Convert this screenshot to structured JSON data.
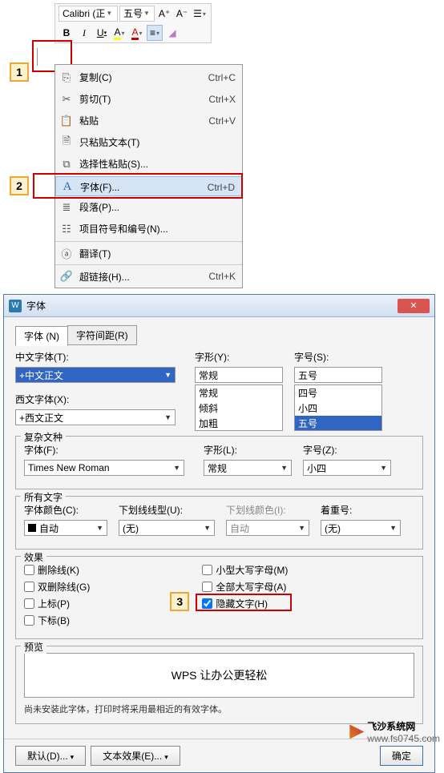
{
  "toolbar": {
    "font": "Calibri (正",
    "size": "五号",
    "inc": "A⁺",
    "dec": "A⁻"
  },
  "ctx": {
    "copy": {
      "label": "复制(C)",
      "sc": "Ctrl+C"
    },
    "cut": {
      "label": "剪切(T)",
      "sc": "Ctrl+X"
    },
    "paste": {
      "label": "粘贴",
      "sc": "Ctrl+V"
    },
    "paste_text": {
      "label": "只粘贴文本(T)"
    },
    "paste_special": {
      "label": "选择性粘贴(S)..."
    },
    "font": {
      "label": "字体(F)...",
      "sc": "Ctrl+D"
    },
    "paragraph": {
      "label": "段落(P)..."
    },
    "bullets": {
      "label": "项目符号和编号(N)..."
    },
    "translate": {
      "label": "翻译(T)"
    },
    "hyperlink": {
      "label": "超链接(H)...",
      "sc": "Ctrl+K"
    }
  },
  "callouts": {
    "c1": "1",
    "c2": "2",
    "c3": "3"
  },
  "dlg": {
    "title": "字体",
    "tabs": {
      "font": "字体 (N)",
      "spacing": "字符间距(R)"
    },
    "cn_font_lbl": "中文字体(T):",
    "cn_font_val": "+中文正文",
    "west_font_lbl": "西文字体(X):",
    "west_font_val": "+西文正文",
    "style_lbl": "字形(Y):",
    "style_val": "常规",
    "style_opts": [
      "常规",
      "倾斜",
      "加粗"
    ],
    "size_lbl": "字号(S):",
    "size_val": "五号",
    "size_opts": [
      "四号",
      "小四",
      "五号"
    ],
    "complex_legend": "复杂文种",
    "complex_font_lbl": "字体(F):",
    "complex_font_val": "Times New Roman",
    "complex_style_lbl": "字形(L):",
    "complex_style_val": "常规",
    "complex_size_lbl": "字号(Z):",
    "complex_size_val": "小四",
    "allchar_legend": "所有文字",
    "color_lbl": "字体颜色(C):",
    "color_val": "自动",
    "underline_lbl": "下划线线型(U):",
    "underline_val": "(无)",
    "ucolor_lbl": "下划线颜色(I):",
    "ucolor_val": "自动",
    "emphasis_lbl": "着重号:",
    "emphasis_val": "(无)",
    "effects_legend": "效果",
    "strike": "删除线(K)",
    "dstrike": "双删除线(G)",
    "sup": "上标(P)",
    "sub": "下标(B)",
    "smallcaps": "小型大写字母(M)",
    "allcaps": "全部大写字母(A)",
    "hidden": "隐藏文字(H)",
    "preview_legend": "预览",
    "preview_text": "WPS 让办公更轻松",
    "note": "尚未安装此字体，打印时将采用最相近的有效字体。",
    "default_btn": "默认(D)...",
    "texteffect_btn": "文本效果(E)...",
    "ok": "确定"
  },
  "wm": {
    "name": "飞沙系统网",
    "url": "www.fs0745.com"
  }
}
